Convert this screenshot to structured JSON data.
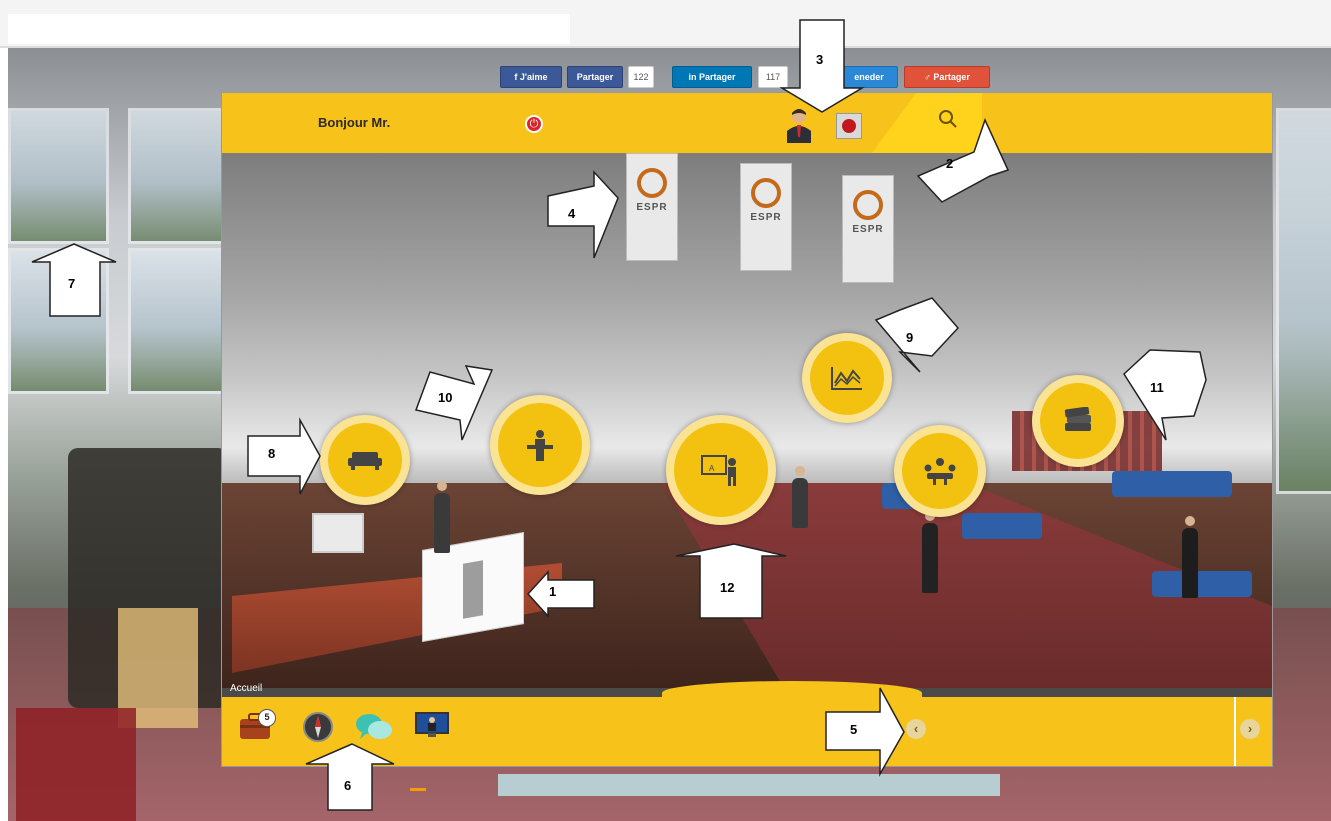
{
  "share_bar": {
    "fb_like": "J'aime",
    "fb_share": "Partager",
    "fb_count": "122",
    "li_share": "Partager",
    "li_count": "117",
    "blue_partial": "eneder",
    "red_share": "Partager"
  },
  "header": {
    "greeting": "Bonjour Mr."
  },
  "banners": [
    {
      "text": "ESPR"
    },
    {
      "text": "ESPR"
    },
    {
      "text": "ESPR"
    }
  ],
  "hotspots": [
    {
      "name": "lounge",
      "icon": "sofa-icon"
    },
    {
      "name": "conference",
      "icon": "lectern-speaker-icon"
    },
    {
      "name": "presentation",
      "icon": "teacher-board-icon"
    },
    {
      "name": "statistics",
      "icon": "line-chart-icon"
    },
    {
      "name": "meeting",
      "icon": "round-table-meeting-icon"
    },
    {
      "name": "library",
      "icon": "books-icon"
    }
  ],
  "scene": {
    "location_label": "Accueil"
  },
  "footer": {
    "bag_badge": "5",
    "icons": [
      "briefcase-icon",
      "compass-icon",
      "chat-bubbles-icon",
      "monitor-presenter-icon"
    ]
  },
  "callouts": [
    "1",
    "2",
    "3",
    "4",
    "5",
    "6",
    "7",
    "8",
    "9",
    "10",
    "11",
    "12"
  ],
  "colors": {
    "accent_yellow": "#f7c21a",
    "hotspot_yellow": "#f3c211",
    "power_red": "#d8262b"
  }
}
